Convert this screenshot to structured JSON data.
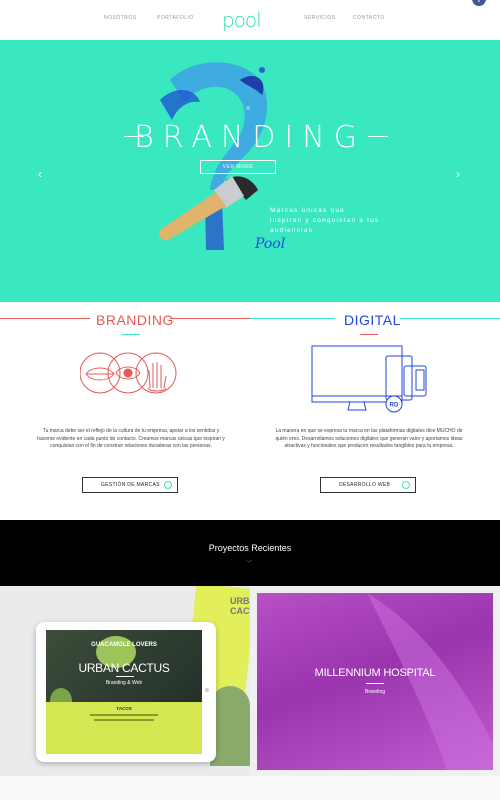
{
  "nav": {
    "items": [
      "NOSOTROS",
      "PORTAFOLIO",
      "SERVICIOS",
      "CONTACTO"
    ],
    "logo": "pool",
    "facebook": "f"
  },
  "hero": {
    "title": "BRANDING",
    "cta_label": "VER MORE",
    "subtitle": "Marcas únicas que inspiran y conquistan a tus audiencias",
    "signature": "Pool",
    "prev_icon": "chevron-left-icon",
    "next_icon": "chevron-right-icon"
  },
  "services": [
    {
      "title": "BRANDING",
      "color": "#e65a57",
      "description": "Tu marca debe ser el reflejo de la cultura de tu empresa, apelar a los sentidos y hacerse evidente en cada punto de contacto. Creamos marcas únicas que inspiran y conquistan con el fin de construir relaciones duraderas con las personas.",
      "button_label": "GESTIÓN DE MARCAS"
    },
    {
      "title": "DIGITAL",
      "color": "#2346d8",
      "description": "La manera en que se expresa tu marca en las plataformas digitales dice MUCHO de quién eres. Desarrollamos soluciones digitales que generan valor y aportamos ideas atractivas y funcionales que producen resultados tangibles para tu empresa.",
      "button_label": "DESARROLLO WEB",
      "badge": "RD"
    }
  ],
  "projects": {
    "heading": "Proyectos Recientes",
    "items": [
      {
        "title": "URBAN CACTUS",
        "overlay": "GUACAMOLE LOVERS",
        "subtitle": "Branding & Web",
        "bag_text": "URBAN CACTUS",
        "footer_label": "TACOS"
      },
      {
        "title": "MILLENNIUM HOSPITAL",
        "subtitle": "Branding"
      }
    ]
  },
  "colors": {
    "accent": "#39e8c1",
    "branding": "#e65a57",
    "digital": "#2346d8"
  }
}
